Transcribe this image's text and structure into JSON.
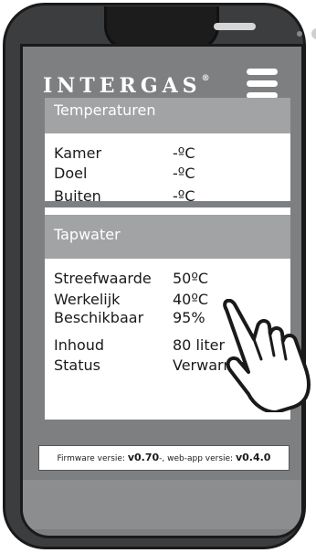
{
  "app": {
    "brand": "INTERGAS",
    "brand_mark": "®",
    "menu_icon": "hamburger-menu-icon"
  },
  "temperaturen": {
    "title": "Temperaturen",
    "rows": [
      {
        "label": "Kamer",
        "value": "-ºC"
      },
      {
        "label": "Doel",
        "value": "-ºC"
      },
      {
        "label": "Buiten",
        "value": "-ºC"
      }
    ]
  },
  "tapwater": {
    "title": "Tapwater",
    "rows": [
      {
        "label": "Streefwaarde",
        "value": "50ºC"
      },
      {
        "label": "Werkelijk",
        "value": "40ºC"
      },
      {
        "label": "Beschikbaar",
        "value": "95%"
      },
      {
        "label": "Inhoud",
        "value": "80 liter"
      },
      {
        "label": "Status",
        "value": "Verwarmen"
      }
    ]
  },
  "firmware": {
    "firmware_label": "Firmware versie: ",
    "firmware_version": "v0.70",
    "webapp_label": "-, web-app versie: ",
    "webapp_version": "v0.4.0"
  },
  "overlay": {
    "icon": "pointing-hand-icon"
  },
  "colors": {
    "header": "#a2a3a5",
    "screen_bg": "#7e7f81",
    "phone_body": "#3c3d3f"
  }
}
